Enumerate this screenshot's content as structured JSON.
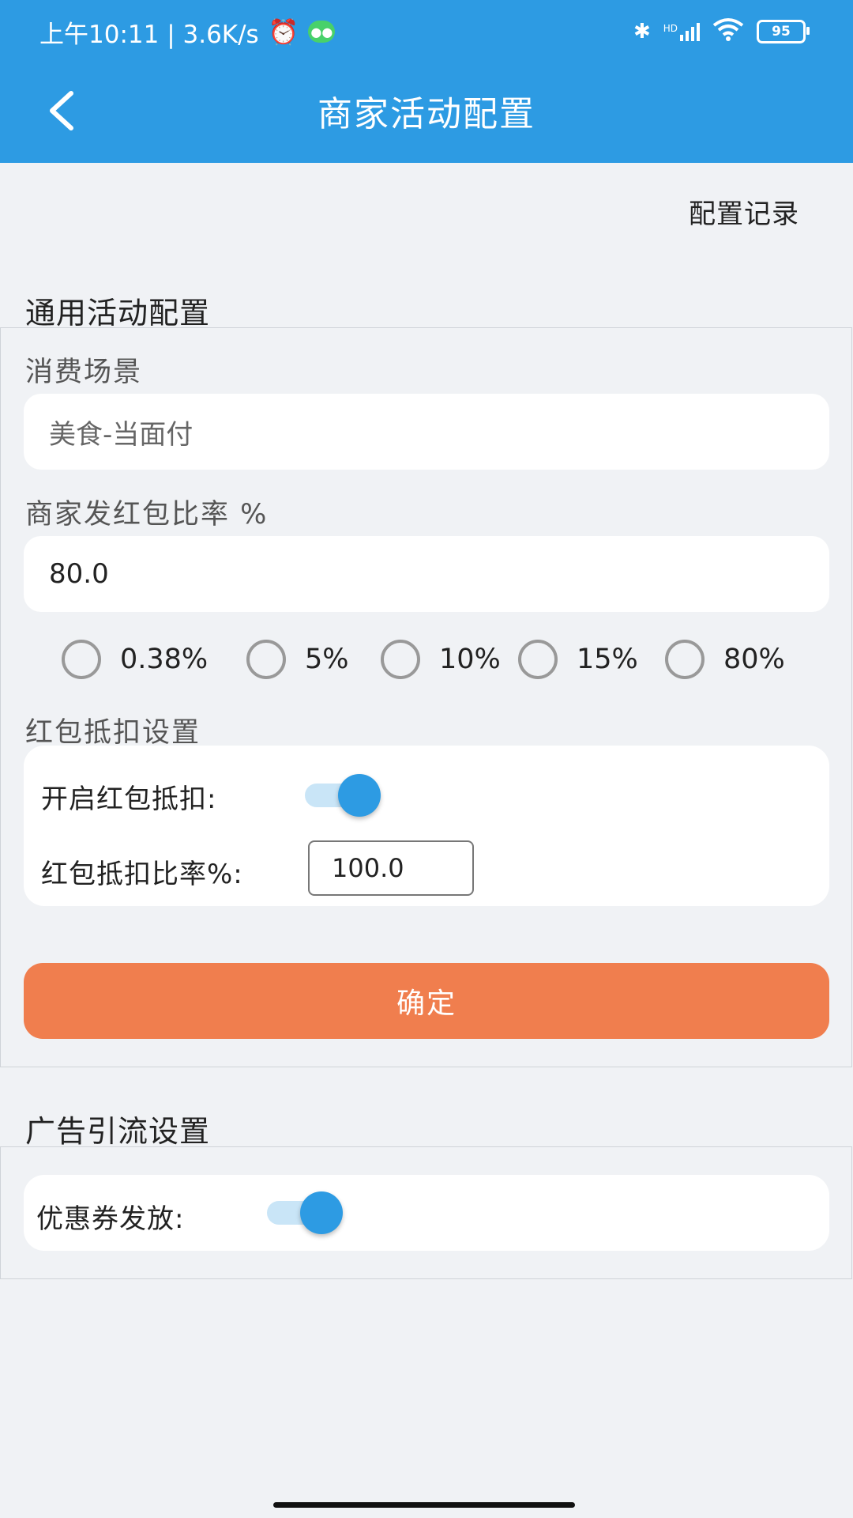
{
  "status_bar": {
    "time_speed": "上午10:11 | 3.6K/s",
    "battery": "95",
    "network_label": "HD"
  },
  "header": {
    "title": "商家活动配置"
  },
  "config_record_link": "配置记录",
  "general_section": {
    "title": "通用活动配置",
    "scene_label": "消费场景",
    "scene_value": "美食-当面付",
    "rate_label": "商家发红包比率 %",
    "rate_value": "80.0",
    "rate_options": [
      "0.38%",
      "5%",
      "10%",
      "15%",
      "80%"
    ],
    "deduction_label": "红包抵扣设置",
    "deduction_enable_label": "开启红包抵扣:",
    "deduction_enabled": true,
    "deduction_rate_label": "红包抵扣比率%:",
    "deduction_rate_value": "100.0",
    "confirm_label": "确定"
  },
  "ad_section": {
    "title": "广告引流设置",
    "coupon_label": "优惠券发放:",
    "coupon_enabled": true
  },
  "colors": {
    "header": "#2d9be3",
    "confirm": "#f07e4e",
    "toggle_on": "#2d9be3"
  }
}
